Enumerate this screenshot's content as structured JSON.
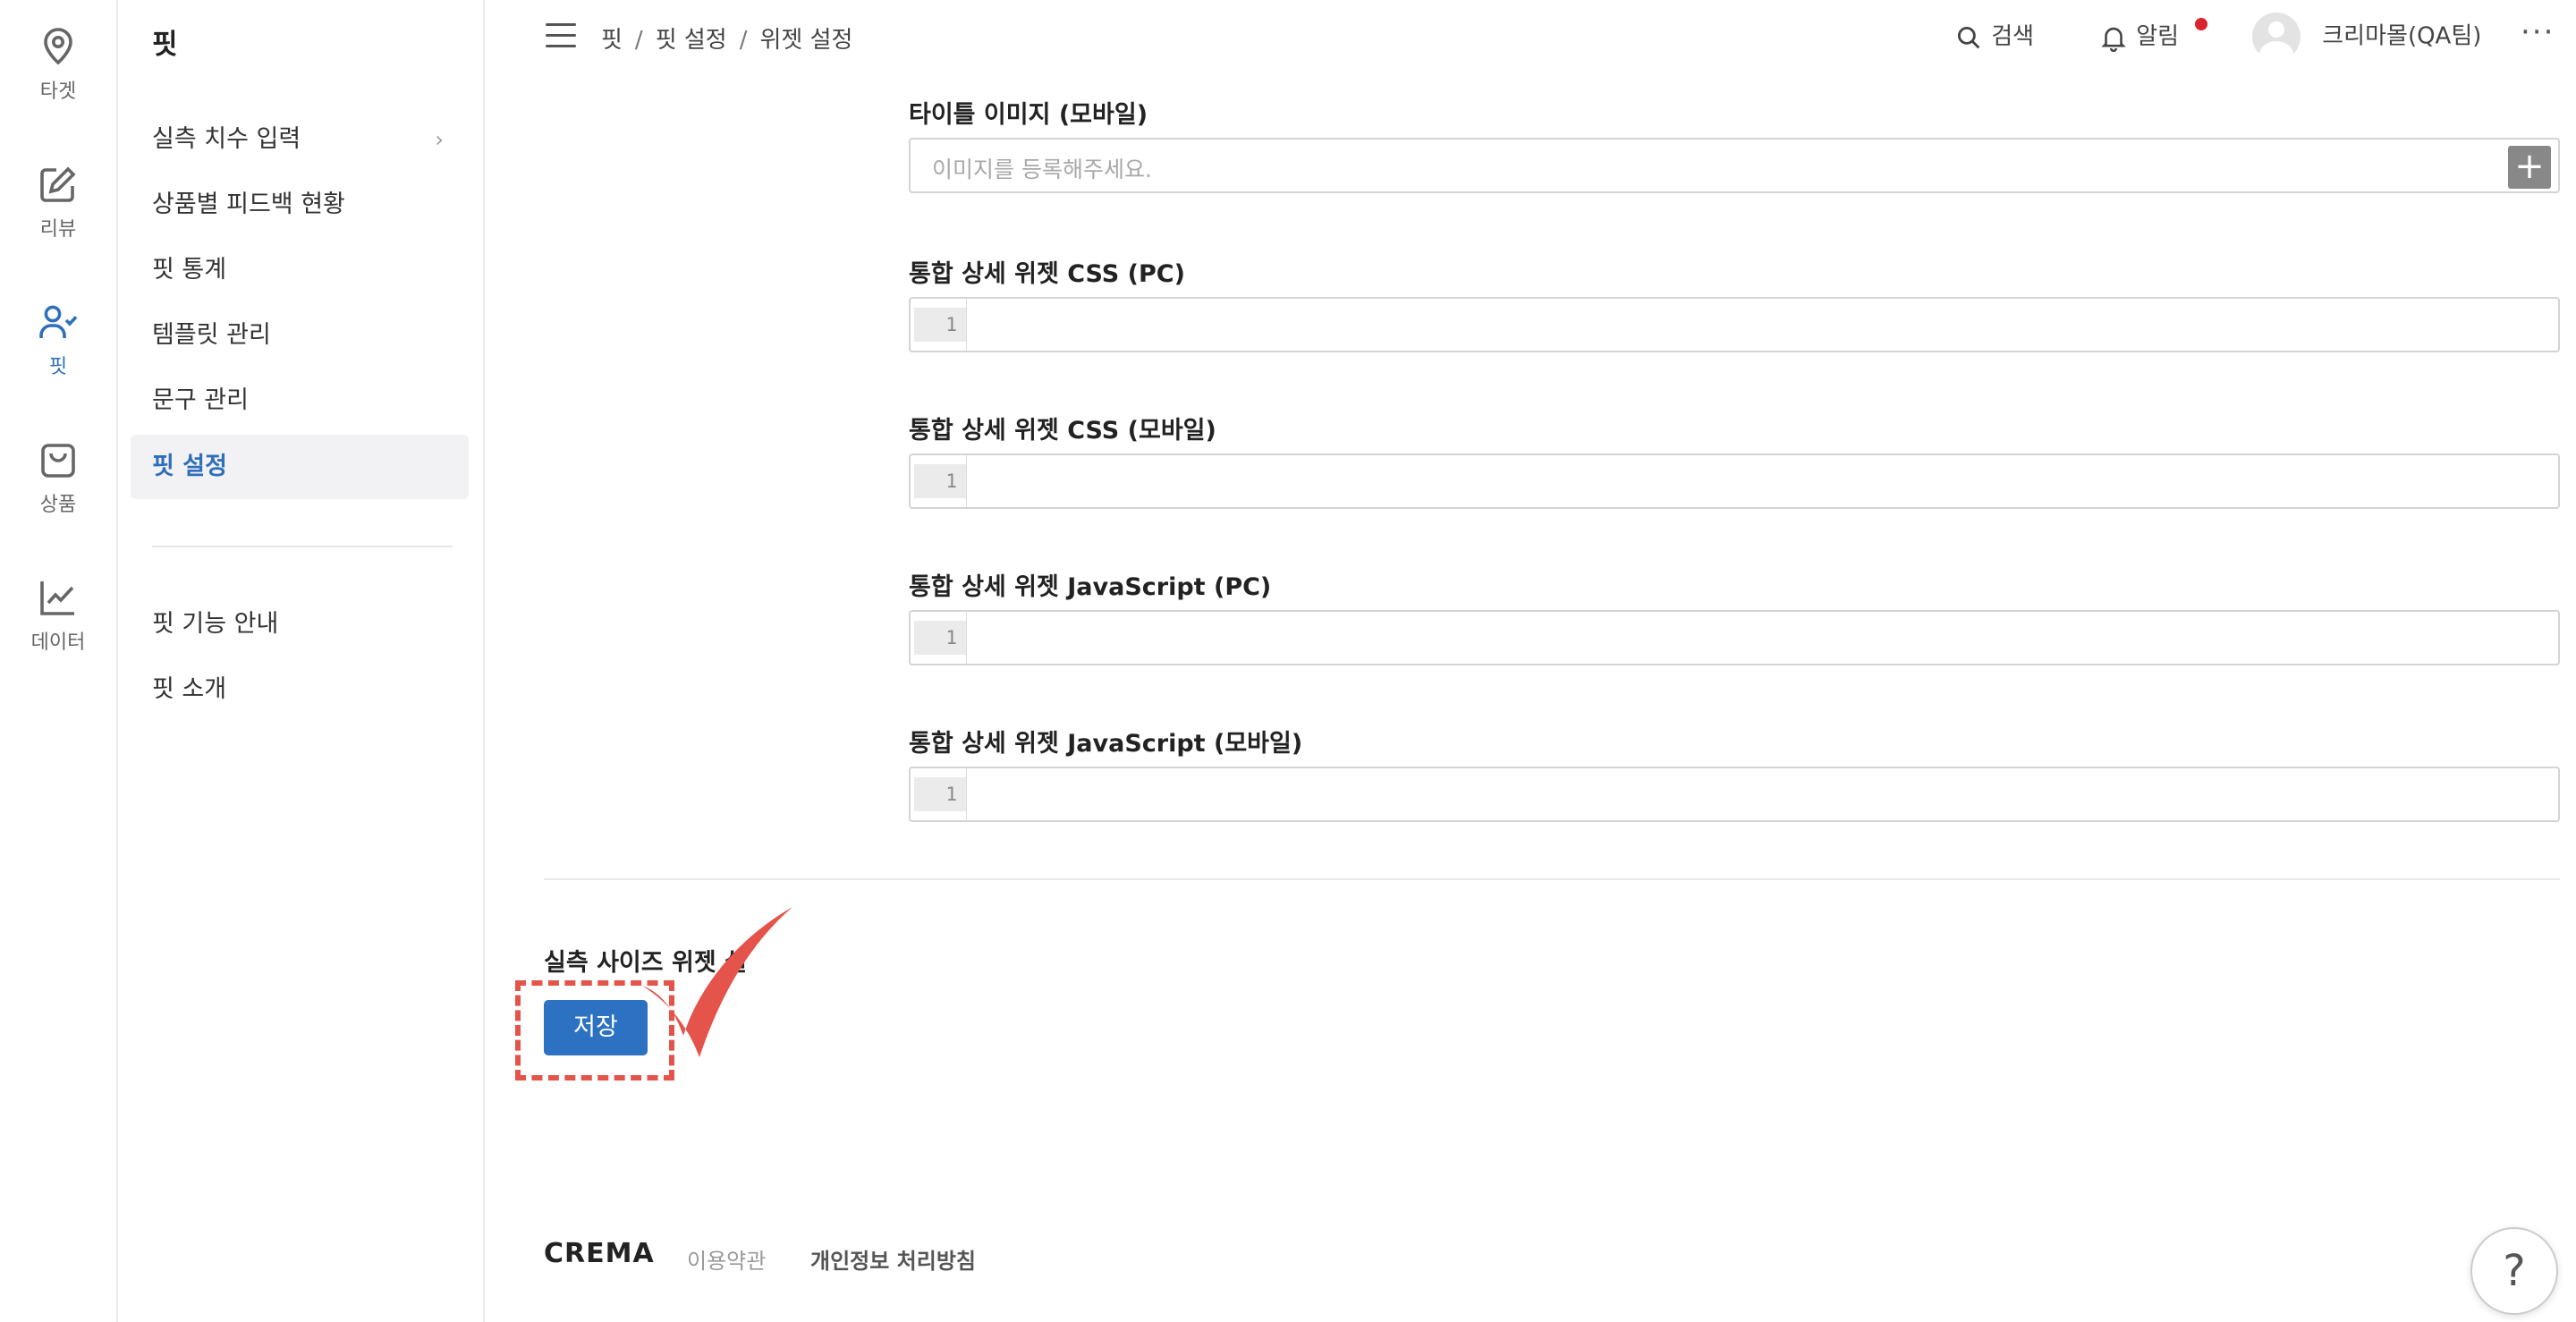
{
  "rail": [
    {
      "label": "타겟",
      "icon": "location-pin-icon"
    },
    {
      "label": "리뷰",
      "icon": "edit-icon"
    },
    {
      "label": "핏",
      "icon": "user-check-icon"
    },
    {
      "label": "상품",
      "icon": "shopping-bag-icon"
    },
    {
      "label": "데이터",
      "icon": "line-chart-icon"
    }
  ],
  "sidebar": {
    "title": "핏",
    "items": [
      {
        "label": "실측 치수 입력",
        "chevron": "›"
      },
      {
        "label": "상품별 피드백 현황"
      },
      {
        "label": "핏 통계"
      },
      {
        "label": "템플릿 관리"
      },
      {
        "label": "문구 관리"
      },
      {
        "label": "핏 설정",
        "active": true
      }
    ],
    "bottom_items": [
      {
        "label": "핏 기능 안내"
      },
      {
        "label": "핏 소개"
      }
    ]
  },
  "header": {
    "breadcrumb": [
      "핏",
      "핏 설정",
      "위젯 설정"
    ],
    "breadcrumb_sep": "/",
    "search_label": "검색",
    "alerts_label": "알림",
    "user_name": "크리마몰(QA팀)",
    "more": "···"
  },
  "form": {
    "title_image_mobile": {
      "label": "타이틀 이미지 (모바일)",
      "placeholder": "이미지를 등록해주세요.",
      "add": "+"
    },
    "css_pc": {
      "label": "통합 상세 위젯 CSS (PC)",
      "line": "1"
    },
    "css_mobile": {
      "label": "통합 상세 위젯 CSS (모바일)",
      "line": "1"
    },
    "js_pc": {
      "label": "통합 상세 위젯 JavaScript (PC)",
      "line": "1"
    },
    "js_mobile": {
      "label": "통합 상세 위젯 JavaScript (모바일)",
      "line": "1"
    }
  },
  "section": {
    "title": "실측 사이즈 위젯 설",
    "save_label": "저장"
  },
  "footer": {
    "brand": "CREMA",
    "terms": "이용약관",
    "privacy": "개인정보 처리방침",
    "help": "?"
  },
  "colors": {
    "accent": "#2d72c2",
    "annotation": "#e4544a",
    "alert_dot": "#d9232d"
  }
}
